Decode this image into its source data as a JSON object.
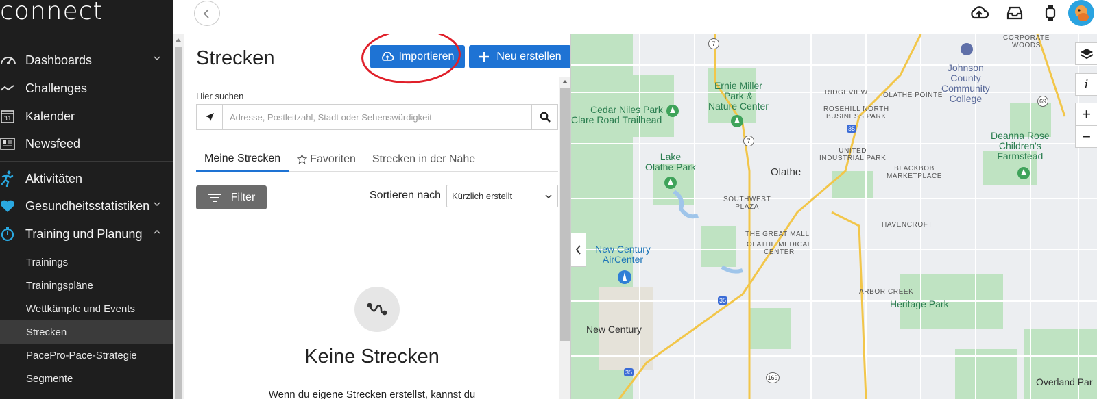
{
  "app": {
    "logo": "connect"
  },
  "sidebar": {
    "items": [
      {
        "label": "Dashboards",
        "icon": "gauge-icon",
        "has_chevron": true
      },
      {
        "label": "Challenges",
        "icon": "trend-icon",
        "has_chevron": false
      },
      {
        "label": "Kalender",
        "icon": "calendar-icon",
        "has_chevron": false
      },
      {
        "label": "Newsfeed",
        "icon": "newspaper-icon",
        "has_chevron": false
      },
      {
        "label": "Aktivitäten",
        "icon": "runner-icon",
        "has_chevron": false
      },
      {
        "label": "Gesundheitsstatistiken",
        "icon": "heart-icon",
        "has_chevron": true
      },
      {
        "label": "Training und Planung",
        "icon": "stopwatch-icon",
        "has_chevron": true,
        "expanded": true
      }
    ],
    "calendar_day": "31",
    "subitems": [
      {
        "label": "Trainings"
      },
      {
        "label": "Trainingspläne"
      },
      {
        "label": "Wettkämpfe und Events"
      },
      {
        "label": "Strecken",
        "active": true
      },
      {
        "label": "PacePro-Pace-Strategie"
      },
      {
        "label": "Segmente"
      }
    ]
  },
  "topbar": {
    "icons": [
      "cloud-upload-icon",
      "inbox-icon",
      "watch-icon",
      "avatar"
    ]
  },
  "main": {
    "title": "Strecken",
    "import_label": "Importieren",
    "new_label": "Neu erstellen",
    "search_label": "Hier suchen",
    "search_placeholder": "Adresse, Postleitzahl, Stadt oder Sehenswürdigkeit",
    "tabs": [
      {
        "label": "Meine Strecken",
        "active": true
      },
      {
        "label": "Favoriten",
        "icon": "star-icon"
      },
      {
        "label": "Strecken in der Nähe"
      }
    ],
    "filter_label": "Filter",
    "sort_label": "Sortieren nach",
    "sort_value": "Kürzlich erstellt",
    "empty_title": "Keine Strecken",
    "empty_text": "Wenn du eigene Strecken erstellst, kannst du"
  },
  "map": {
    "labels": {
      "corporate_woods": "CORPORATE\nWOODS",
      "johnson_county": "Johnson\nCounty\nCommunity\nCollege",
      "ernie_miller": "Ernie Miller\nPark &\nNature Center",
      "cedar_niles": "Cedar Niles Park",
      "clare_road": "Clare Road Trailhead",
      "ridgeview": "RIDGEVIEW",
      "olathe_pointe": "OLATHE POINTE",
      "rosehill": "ROSEHILL NORTH\nBUSINESS PARK",
      "deanna_rose": "Deanna Rose\nChildren's\nFarmstead",
      "lake_olathe": "Lake\nOlathe Park",
      "united": "UNITED\nINDUSTRIAL PARK",
      "olathe": "Olathe",
      "blackbob": "BLACKBOB\nMARKETPLACE",
      "southwest_plaza": "SOUTHWEST\nPLAZA",
      "havencroft": "HAVENCROFT",
      "great_mall": "THE GREAT MALL",
      "olathe_medical": "OLATHE MEDICAL\nCENTER",
      "new_century_aircenter": "New Century\nAirCenter",
      "arbor_creek": "ARBOR CREEK",
      "heritage_park": "Heritage Park",
      "new_century": "New Century",
      "overland_park": "Overland Par"
    },
    "shields": [
      "7",
      "7",
      "35",
      "69",
      "35",
      "35",
      "169"
    ],
    "controls": {
      "zoom_in": "+",
      "zoom_out": "−",
      "info": "i"
    }
  }
}
